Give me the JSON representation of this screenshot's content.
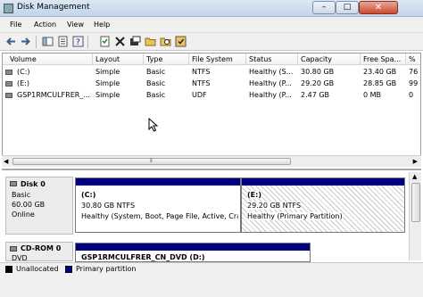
{
  "window": {
    "title": "Disk Management",
    "buttons": {
      "minimize": "–",
      "maximize": "□",
      "close": "✕"
    }
  },
  "menu": [
    "File",
    "Action",
    "View",
    "Help"
  ],
  "toolbar": {
    "icons": [
      "back-icon",
      "forward-icon",
      "console-tree-icon",
      "help-icon",
      "properties-icon",
      "delete-icon",
      "export-icon",
      "open-folder-icon",
      "search-icon",
      "settings-icon"
    ]
  },
  "volume_table": {
    "columns": [
      "Volume",
      "Layout",
      "Type",
      "File System",
      "Status",
      "Capacity",
      "Free Spa...",
      "%"
    ],
    "rows": [
      {
        "volume": "(C:)",
        "layout": "Simple",
        "type": "Basic",
        "fs": "NTFS",
        "status": "Healthy (S...",
        "capacity": "30.80 GB",
        "free": "23.40 GB",
        "pct": "76"
      },
      {
        "volume": "(E:)",
        "layout": "Simple",
        "type": "Basic",
        "fs": "NTFS",
        "status": "Healthy (P...",
        "capacity": "29.20 GB",
        "free": "28.85 GB",
        "pct": "99"
      },
      {
        "volume": "GSP1RMCULFRER_...",
        "layout": "Simple",
        "type": "Basic",
        "fs": "UDF",
        "status": "Healthy (P...",
        "capacity": "2.47 GB",
        "free": "0 MB",
        "pct": "0"
      }
    ]
  },
  "disks": {
    "disk0": {
      "name": "Disk 0",
      "type": "Basic",
      "size": "60.00 GB",
      "state": "Online",
      "partitions": [
        {
          "title": "(C:)",
          "size": "30.80 GB NTFS",
          "status": "Healthy (System, Boot, Page File, Active, Cra"
        },
        {
          "title": "(E:)",
          "size": "29.20 GB NTFS",
          "status": "Healthy (Primary Partition)"
        }
      ]
    },
    "cdrom0": {
      "name": "CD-ROM 0",
      "type": "DVD",
      "partitions": [
        {
          "title": "GSP1RMCULFRER_CN_DVD  (D:)"
        }
      ]
    }
  },
  "legend": [
    {
      "label": "Unallocated",
      "color": "#000000"
    },
    {
      "label": "Primary partition",
      "color": "#000080"
    }
  ]
}
